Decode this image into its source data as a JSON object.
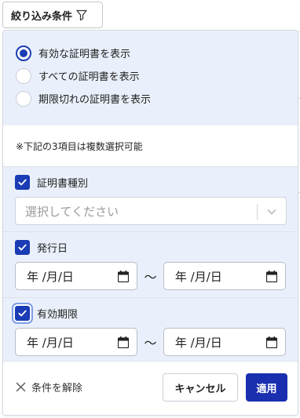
{
  "toggle": {
    "label": "絞り込み条件",
    "icon": "filter-icon"
  },
  "radios": [
    {
      "label": "有効な証明書を表示",
      "checked": true
    },
    {
      "label": "すべての証明書を表示",
      "checked": false
    },
    {
      "label": "期限切れの証明書を表示",
      "checked": false
    }
  ],
  "note": "※下記の3項目は複数選択可能",
  "cert_type": {
    "label": "証明書種別",
    "checked": true,
    "placeholder": "選択してください"
  },
  "issue_date": {
    "label": "発行日",
    "checked": true,
    "from": "年 /月/日",
    "to": "年 /月/日",
    "separator": "〜"
  },
  "expiry": {
    "label": "有効期限",
    "checked": true,
    "from": "年 /月/日",
    "to": "年 /月/日",
    "separator": "〜"
  },
  "footer": {
    "clear_label": "条件を解除",
    "cancel_label": "キャンセル",
    "apply_label": "適用"
  },
  "colors": {
    "accent": "#1a3cb4",
    "apply_bg": "#1a2fb0",
    "section_bg": "#eaf0fb"
  }
}
